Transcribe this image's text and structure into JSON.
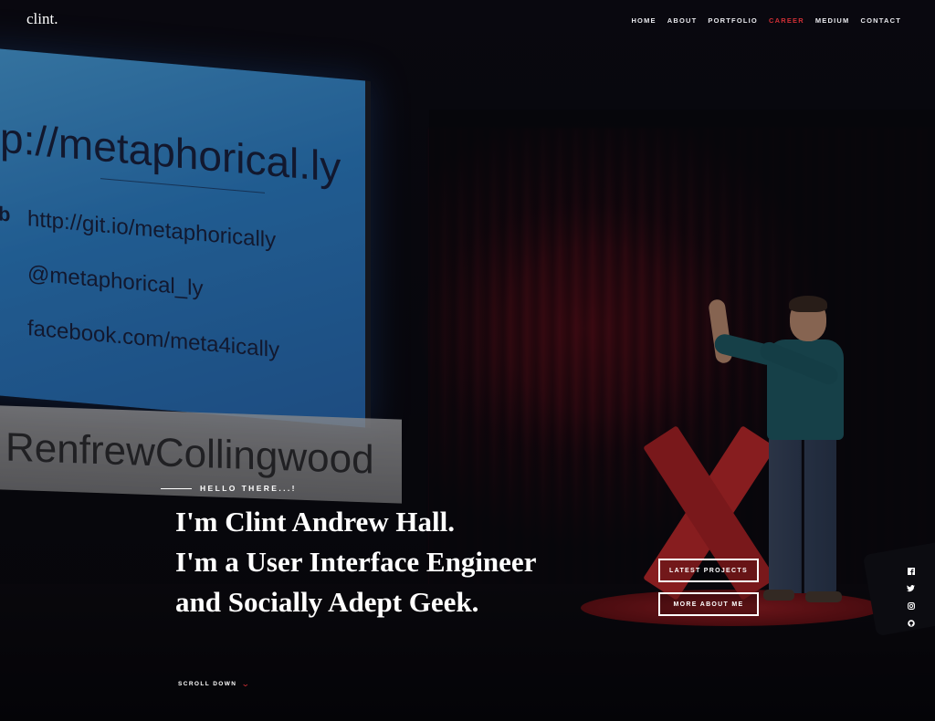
{
  "site": {
    "logo": "clint."
  },
  "nav": [
    {
      "label": "HOME",
      "active": false
    },
    {
      "label": "ABOUT",
      "active": false
    },
    {
      "label": "PORTFOLIO",
      "active": false
    },
    {
      "label": "CAREER",
      "active": true
    },
    {
      "label": "MEDIUM",
      "active": false
    },
    {
      "label": "CONTACT",
      "active": false
    }
  ],
  "hero": {
    "slide": {
      "url": "p://metaphorical.ly",
      "bullet": "b",
      "git": "http://git.io/metaphorically",
      "twitter": "@metaphorical_ly",
      "facebook": "facebook.com/meta4ically"
    },
    "sign": "RenfrewCollingwood",
    "kicker": "HELLO THERE...!",
    "headline": [
      "I'm Clint Andrew Hall.",
      "I'm a User Interface Engineer",
      "and Socially Adept Geek."
    ],
    "buttons": {
      "latest": "LATEST PROJECTS",
      "about": "MORE ABOUT ME"
    },
    "scroll": "SCROLL DOWN"
  },
  "social": [
    "facebook-icon",
    "twitter-icon",
    "instagram-icon",
    "github-icon"
  ],
  "colors": {
    "accent": "#cf2f35",
    "background": "#0b0a10"
  }
}
